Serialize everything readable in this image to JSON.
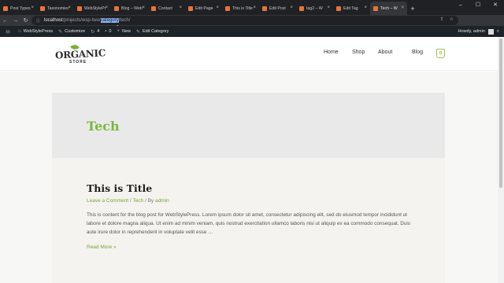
{
  "browser": {
    "tabs": [
      {
        "title": "Post Types",
        "fav": "#e8743b",
        "round": false
      },
      {
        "title": "Taxonomies",
        "fav": "#e8743b",
        "round": false
      },
      {
        "title": "WebStylePress",
        "fav": "#e8743b",
        "round": false
      },
      {
        "title": "Blog – WebStylePress",
        "fav": "#e8743b",
        "round": false
      },
      {
        "title": "Contact",
        "fav": "#e8743b",
        "round": false
      },
      {
        "title": "Edit Page",
        "fav": "#e8743b",
        "round": false
      },
      {
        "title": "This is Title",
        "fav": "#e8743b",
        "round": false
      },
      {
        "title": "Edit Post",
        "fav": "#e8743b",
        "round": false
      },
      {
        "title": "tag2 – W",
        "fav": "#e8743b",
        "round": false
      },
      {
        "title": "Edit Tag",
        "fav": "#e8743b",
        "round": false
      },
      {
        "title": "Tech – W",
        "fav": "#e8743b",
        "round": false,
        "active": true
      }
    ],
    "tab_close": "×",
    "new_tab": "+",
    "url_host": "localhost",
    "url_pre": "/projects/wsp-two/",
    "url_selected": "category",
    "url_post": "/tech/",
    "win_minimize": "–",
    "win_maximize": "☐",
    "win_close": "✕"
  },
  "admin_bar": {
    "site_name": "WebStylePress",
    "customize": "Customize",
    "updates_count": "4",
    "comments_count": "0",
    "new": "New",
    "edit_category": "Edit Category",
    "howdy": "Howdy, admin"
  },
  "site": {
    "logo_text": "ORGANIC",
    "logo_sub": "STORE",
    "nav": [
      "Home",
      "Shop",
      "About",
      "Blog"
    ],
    "cart_count": "0"
  },
  "archive": {
    "title": "Tech"
  },
  "post": {
    "title": "This is Title",
    "meta_comment": "Leave a Comment",
    "meta_sep1": " / ",
    "meta_category": "Tech",
    "meta_sep2": " / By ",
    "meta_author": "admin",
    "excerpt": "This is content for the blog post for WebStylePress. Lorem ipsum dolor sit amet, consectetur adipiscing elit, sed do eiusmod tempor incididunt ut labore et dolore magna aliqua. Ut enim ad minim veniam, quis nostrud exercitation ullamco laboris nisi ut aliquip ex ea commodo consequat. Duis aute irure dolor in reprehenderit in voluptate velit esse …",
    "read_more": "Read More »"
  },
  "colors": {
    "accent_green": "#7bb83d",
    "admin_bar": "#1d2327"
  }
}
